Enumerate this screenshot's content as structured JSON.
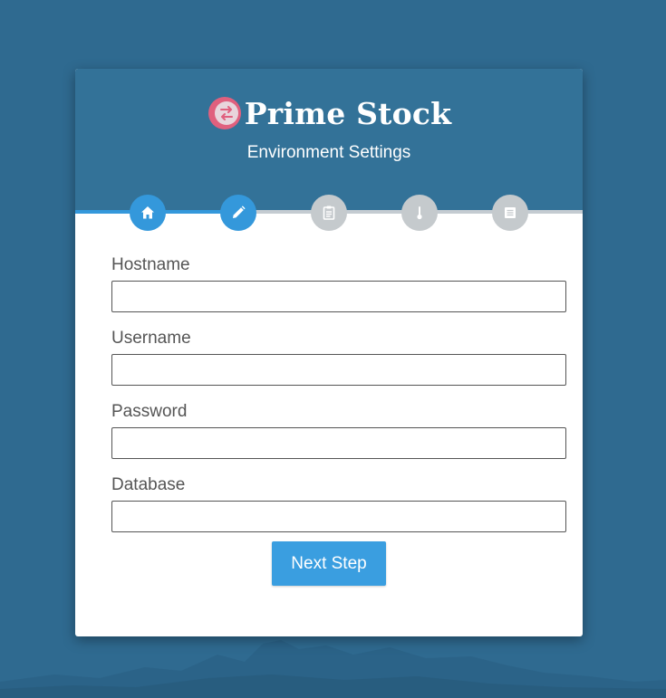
{
  "colors": {
    "page_background": "#2f6a90",
    "header_background": "#337298",
    "accent": "#3498db",
    "step_inactive": "#c5cacd",
    "logo_pink": "#e0607e"
  },
  "header": {
    "brand_name": "Prime Stock",
    "subtitle": "Environment Settings",
    "logo_icon": "swap-arrows-icon"
  },
  "stepper": {
    "progress": 0.32,
    "steps": [
      {
        "icon": "home-icon",
        "active": true
      },
      {
        "icon": "pencil-icon",
        "active": true
      },
      {
        "icon": "clipboard-icon",
        "active": false
      },
      {
        "icon": "thermometer-icon",
        "active": false
      },
      {
        "icon": "list-icon",
        "active": false
      }
    ]
  },
  "form": {
    "fields": [
      {
        "label": "Hostname",
        "value": ""
      },
      {
        "label": "Username",
        "value": ""
      },
      {
        "label": "Password",
        "value": ""
      },
      {
        "label": "Database",
        "value": ""
      }
    ],
    "submit_label": "Next Step"
  }
}
